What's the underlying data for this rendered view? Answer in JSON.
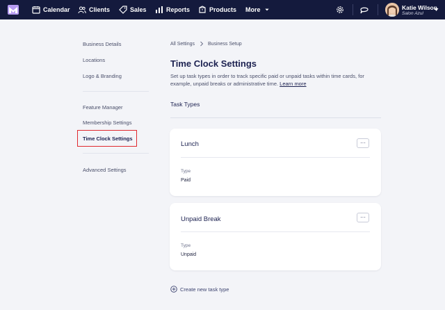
{
  "nav": {
    "items": [
      {
        "label": "Calendar",
        "icon": "calendar-icon"
      },
      {
        "label": "Clients",
        "icon": "users-icon"
      },
      {
        "label": "Sales",
        "icon": "tag-icon"
      },
      {
        "label": "Reports",
        "icon": "bar-chart-icon"
      },
      {
        "label": "Products",
        "icon": "box-icon"
      }
    ],
    "more_label": "More",
    "user": {
      "name": "Katie Wilson",
      "business": "Salon Azul"
    }
  },
  "sidebar": {
    "group1": [
      "Business Details",
      "Locations",
      "Logo & Branding"
    ],
    "group2": [
      "Feature Manager",
      "Membership Settings",
      "Time Clock Settings"
    ],
    "group3": [
      "Advanced Settings"
    ]
  },
  "breadcrumb": {
    "root": "All Settings",
    "current": "Business Setup"
  },
  "page": {
    "title": "Time Clock Settings",
    "description": "Set up task types in order to track specific paid or unpaid tasks within time cards, for example, unpaid breaks or administrative time.",
    "learn_more": "Learn more",
    "section_title": "Task Types"
  },
  "task_types": [
    {
      "name": "Lunch",
      "type_label": "Type",
      "type_value": "Paid"
    },
    {
      "name": "Unpaid Break",
      "type_label": "Type",
      "type_value": "Unpaid"
    }
  ],
  "create_label": "Create new task type",
  "colors": {
    "nav_bg": "#141a3d",
    "highlight": "#e0282e",
    "page_bg": "#f3f4f8"
  }
}
